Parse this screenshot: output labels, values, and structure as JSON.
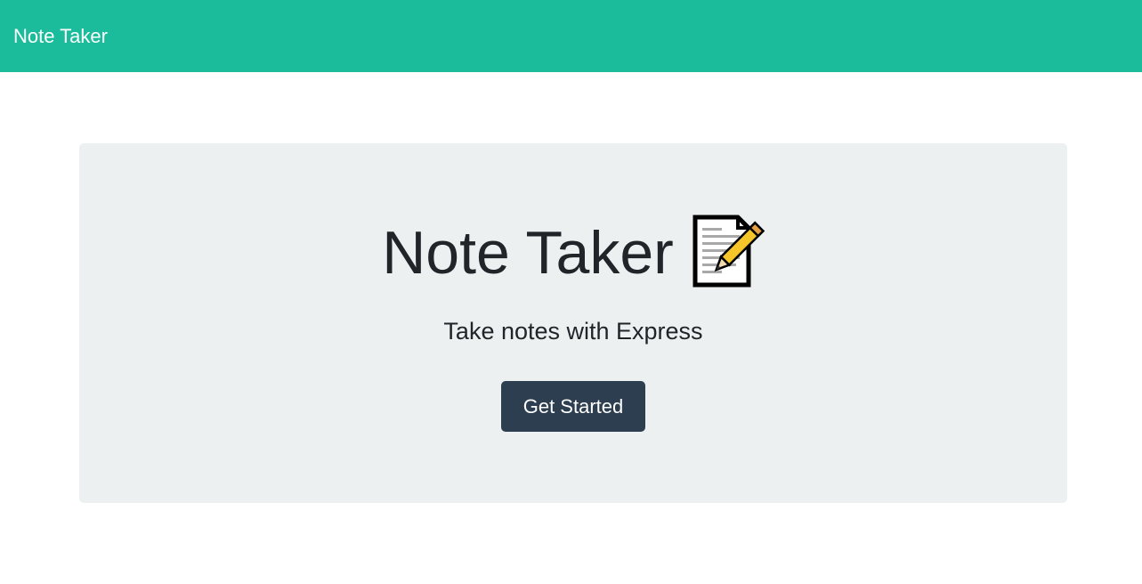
{
  "navbar": {
    "brand": "Note Taker",
    "background_color": "#1abc9c"
  },
  "hero": {
    "title": "Note Taker",
    "title_icon": "memo-icon",
    "subtitle": "Take notes with Express",
    "button_label": "Get Started",
    "button_color": "#2c3e50",
    "panel_color": "#ecf0f1"
  }
}
